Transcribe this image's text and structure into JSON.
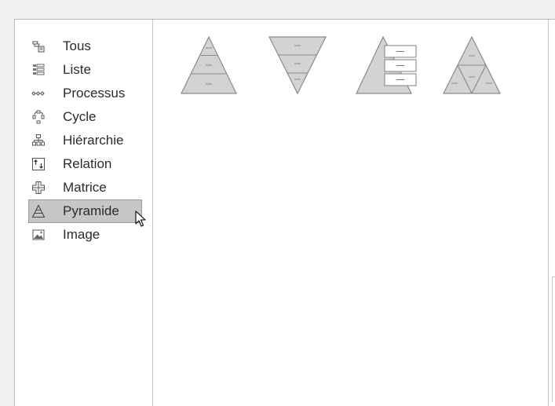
{
  "categories": [
    {
      "label": "Tous",
      "icon": "all-icon",
      "selected": false
    },
    {
      "label": "Liste",
      "icon": "list-icon",
      "selected": false
    },
    {
      "label": "Processus",
      "icon": "process-icon",
      "selected": false
    },
    {
      "label": "Cycle",
      "icon": "cycle-icon",
      "selected": false
    },
    {
      "label": "Hiérarchie",
      "icon": "hierarchy-icon",
      "selected": false
    },
    {
      "label": "Relation",
      "icon": "relationship-icon",
      "selected": false
    },
    {
      "label": "Matrice",
      "icon": "matrix-icon",
      "selected": false
    },
    {
      "label": "Pyramide",
      "icon": "pyramid-icon",
      "selected": true
    },
    {
      "label": "Image",
      "icon": "picture-icon",
      "selected": false
    }
  ],
  "gallery": {
    "items": [
      {
        "icon": "basic-pyramid-icon"
      },
      {
        "icon": "inverted-pyramid-icon"
      },
      {
        "icon": "pyramid-list-icon"
      },
      {
        "icon": "segmented-pyramid-icon"
      }
    ]
  },
  "colors": {
    "selected_bg": "#c6c6c6",
    "thumb_fill": "#d3d3d3",
    "thumb_stroke": "#8a8a8a"
  }
}
